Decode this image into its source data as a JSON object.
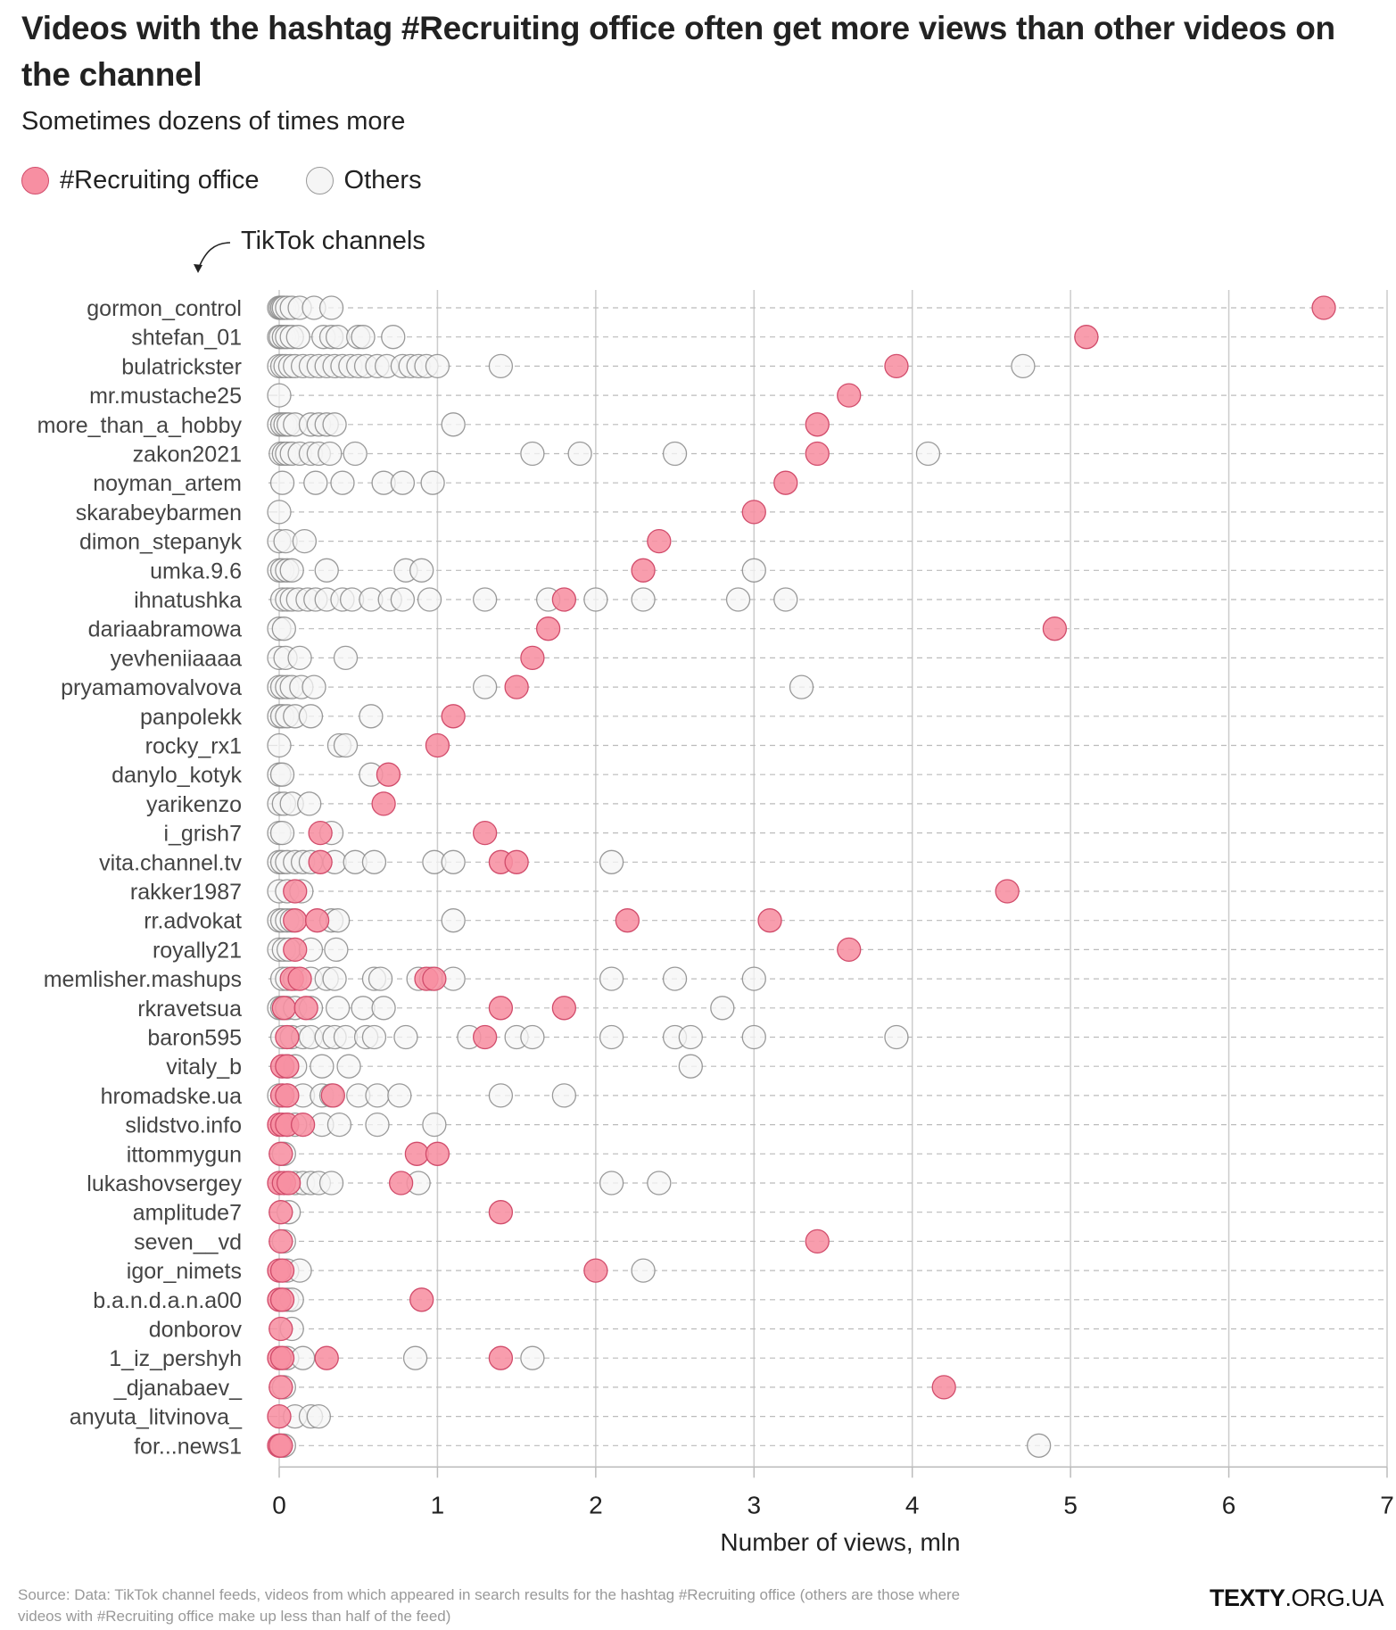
{
  "title": "Videos with the hashtag #Recruiting office often get more views than other videos on the channel",
  "subtitle": "Sometimes dozens of times more",
  "legend": {
    "recruiting_label": "#Recruiting office",
    "others_label": "Others"
  },
  "annotation": "TikTok channels",
  "source": "Source: Data: TikTok channel feeds, videos from which appeared in search results for the hashtag #Recruiting office (others are those where videos with #Recruiting office make up less than half of the feed)",
  "brand": {
    "bold": "TEXTY",
    "rest": ".ORG.UA"
  },
  "colors": {
    "recruiting_fill": "#f78fa2",
    "recruiting_stroke": "#d14c6b",
    "others_fill": "#f5f5f5",
    "others_stroke": "#888888"
  },
  "chart_data": {
    "type": "scatter",
    "title": "Videos with the hashtag #Recruiting office often get more views than other videos on the channel",
    "subtitle": "Sometimes dozens of times more",
    "xlabel": "Number of views, mln",
    "ylabel": "TikTok channels",
    "xlim": [
      0,
      7
    ],
    "xticks": [
      "0",
      "1",
      "2",
      "3",
      "4",
      "5",
      "6",
      "7"
    ],
    "grid": true,
    "legend_position": "top-left",
    "series_names": [
      "#Recruiting office",
      "Others"
    ],
    "rows": [
      {
        "channel": "gormon_control",
        "recruiting": [
          6.6
        ],
        "others": [
          0,
          0.01,
          0.02,
          0.03,
          0.05,
          0.08,
          0.13,
          0.22,
          0.33
        ]
      },
      {
        "channel": "shtefan_01",
        "recruiting": [
          5.1
        ],
        "others": [
          0,
          0.01,
          0.03,
          0.05,
          0.08,
          0.12,
          0.28,
          0.33,
          0.37,
          0.5,
          0.53,
          0.72
        ]
      },
      {
        "channel": "bulatrickster",
        "recruiting": [
          3.9
        ],
        "others": [
          0,
          0.02,
          0.04,
          0.07,
          0.1,
          0.15,
          0.2,
          0.25,
          0.3,
          0.35,
          0.4,
          0.45,
          0.5,
          0.55,
          0.62,
          0.68,
          0.78,
          0.83,
          0.88,
          0.93,
          1.0,
          1.4,
          4.7
        ]
      },
      {
        "channel": "mr.mustache25",
        "recruiting": [
          3.6
        ],
        "others": [
          0
        ]
      },
      {
        "channel": "more_than_a_hobby",
        "recruiting": [
          3.4
        ],
        "others": [
          0,
          0.02,
          0.04,
          0.06,
          0.1,
          0.2,
          0.25,
          0.3,
          0.35,
          1.1
        ]
      },
      {
        "channel": "zakon2021",
        "recruiting": [
          3.4
        ],
        "others": [
          0.01,
          0.03,
          0.05,
          0.08,
          0.13,
          0.2,
          0.25,
          0.32,
          0.48,
          1.6,
          1.9,
          2.5,
          4.1
        ]
      },
      {
        "channel": "noyman_artem",
        "recruiting": [
          3.2
        ],
        "others": [
          0.02,
          0.23,
          0.4,
          0.66,
          0.78,
          0.97
        ]
      },
      {
        "channel": "skarabeybarmen",
        "recruiting": [
          3.0
        ],
        "others": [
          0
        ]
      },
      {
        "channel": "dimon_stepanyk",
        "recruiting": [
          2.4
        ],
        "others": [
          0,
          0.04,
          0.16
        ]
      },
      {
        "channel": "umka.9.6",
        "recruiting": [
          2.3
        ],
        "others": [
          0,
          0.02,
          0.05,
          0.08,
          0.3,
          0.8,
          0.9,
          3.0
        ]
      },
      {
        "channel": "ihnatushka",
        "recruiting": [
          1.8
        ],
        "others": [
          0.02,
          0.05,
          0.08,
          0.12,
          0.18,
          0.23,
          0.3,
          0.4,
          0.46,
          0.58,
          0.7,
          0.78,
          0.95,
          1.3,
          1.7,
          2.0,
          2.3,
          2.9,
          3.2
        ]
      },
      {
        "channel": "dariaabramowa",
        "recruiting": [
          1.7,
          4.9
        ],
        "others": [
          0,
          0.03
        ]
      },
      {
        "channel": "yevheniiaaaa",
        "recruiting": [
          1.6
        ],
        "others": [
          0,
          0.04,
          0.13,
          0.42
        ]
      },
      {
        "channel": "pryamamovalvova",
        "recruiting": [
          1.5
        ],
        "others": [
          0,
          0.02,
          0.05,
          0.08,
          0.14,
          0.22,
          1.3,
          3.3
        ]
      },
      {
        "channel": "panpolekk",
        "recruiting": [
          1.1
        ],
        "others": [
          0,
          0.02,
          0.05,
          0.1,
          0.2,
          0.58
        ]
      },
      {
        "channel": "rocky_rx1",
        "recruiting": [
          1.0
        ],
        "others": [
          0,
          0.38,
          0.42
        ]
      },
      {
        "channel": "danylo_kotyk",
        "recruiting": [
          0.69
        ],
        "others": [
          0,
          0.02,
          0.58
        ]
      },
      {
        "channel": "yarikenzo",
        "recruiting": [
          0.66
        ],
        "others": [
          0,
          0.03,
          0.08,
          0.19
        ]
      },
      {
        "channel": "i_grish7",
        "recruiting": [
          0.26,
          1.3
        ],
        "others": [
          0,
          0.02,
          0.33
        ]
      },
      {
        "channel": "vita.channel.tv",
        "recruiting": [
          0.26,
          1.4,
          1.5
        ],
        "others": [
          0,
          0.02,
          0.05,
          0.1,
          0.15,
          0.2,
          0.35,
          0.48,
          0.6,
          0.98,
          1.1,
          2.1
        ]
      },
      {
        "channel": "rakker1987",
        "recruiting": [
          0.1,
          4.6
        ],
        "others": [
          0,
          0.05,
          0.14
        ]
      },
      {
        "channel": "rr.advokat",
        "recruiting": [
          0.1,
          0.24,
          2.2,
          3.1
        ],
        "others": [
          0,
          0.02,
          0.05,
          0.08,
          0.33,
          0.37,
          1.1
        ]
      },
      {
        "channel": "royally21",
        "recruiting": [
          0.1,
          3.6
        ],
        "others": [
          0,
          0.03,
          0.06,
          0.2,
          0.36
        ]
      },
      {
        "channel": "memlisher.mashups",
        "recruiting": [
          0.08,
          0.13,
          0.93,
          0.98
        ],
        "others": [
          0.02,
          0.05,
          0.1,
          0.2,
          0.3,
          0.35,
          0.6,
          0.64,
          0.88,
          0.96,
          1.1,
          2.1,
          2.5,
          3.0
        ]
      },
      {
        "channel": "rkravetsua",
        "recruiting": [
          0.03,
          0.17,
          1.4,
          1.8
        ],
        "others": [
          0,
          0.02,
          0.05,
          0.1,
          0.2,
          0.37,
          0.53,
          0.66,
          2.8
        ]
      },
      {
        "channel": "baron595",
        "recruiting": [
          0.05,
          1.3
        ],
        "others": [
          0.02,
          0.08,
          0.15,
          0.2,
          0.3,
          0.35,
          0.42,
          0.55,
          0.6,
          0.8,
          1.2,
          1.5,
          1.6,
          2.1,
          2.5,
          2.6,
          3.0,
          3.9
        ]
      },
      {
        "channel": "vitaly_b",
        "recruiting": [
          0.02,
          0.05
        ],
        "others": [
          0.05,
          0.1,
          0.27,
          0.44,
          2.6
        ]
      },
      {
        "channel": "hromadske.ua",
        "recruiting": [
          0.02,
          0.05,
          0.34
        ],
        "others": [
          0,
          0.05,
          0.15,
          0.27,
          0.33,
          0.5,
          0.62,
          0.76,
          1.4,
          1.8
        ]
      },
      {
        "channel": "slidstvo.info",
        "recruiting": [
          0,
          0.02,
          0.05,
          0.15
        ],
        "others": [
          0.05,
          0.1,
          0.27,
          0.38,
          0.62,
          0.98
        ]
      },
      {
        "channel": "ittommygun",
        "recruiting": [
          0.01,
          0.87,
          1.0
        ],
        "others": [
          0.03
        ]
      },
      {
        "channel": "lukashovsergey",
        "recruiting": [
          0,
          0.03,
          0.06,
          0.77
        ],
        "others": [
          0.05,
          0.1,
          0.15,
          0.2,
          0.25,
          0.33,
          0.88,
          2.1,
          2.4
        ]
      },
      {
        "channel": "amplitude7",
        "recruiting": [
          0.01,
          1.4
        ],
        "others": [
          0.06
        ]
      },
      {
        "channel": "seven__vd",
        "recruiting": [
          0.01,
          3.4
        ],
        "others": [
          0.03
        ]
      },
      {
        "channel": "igor_nimets",
        "recruiting": [
          0,
          0.02,
          2.0
        ],
        "others": [
          0.05,
          0.13,
          2.3
        ]
      },
      {
        "channel": "b.a.n.d.a.n.a00",
        "recruiting": [
          0,
          0.02,
          0.9
        ],
        "others": [
          0.05,
          0.08
        ]
      },
      {
        "channel": "donborov",
        "recruiting": [
          0.01
        ],
        "others": [
          0.08
        ]
      },
      {
        "channel": "1_iz_pershyh",
        "recruiting": [
          0,
          0.02,
          0.3,
          1.4
        ],
        "others": [
          0.05,
          0.15,
          0.86,
          1.6
        ]
      },
      {
        "channel": "_djanabaev_",
        "recruiting": [
          0.01,
          4.2
        ],
        "others": [
          0.03
        ]
      },
      {
        "channel": "anyuta_litvinova_",
        "recruiting": [
          0
        ],
        "others": [
          0.1,
          0.2,
          0.25
        ]
      },
      {
        "channel": "for...news1",
        "recruiting": [
          0,
          0.01
        ],
        "others": [
          0.03,
          4.8
        ]
      }
    ]
  }
}
